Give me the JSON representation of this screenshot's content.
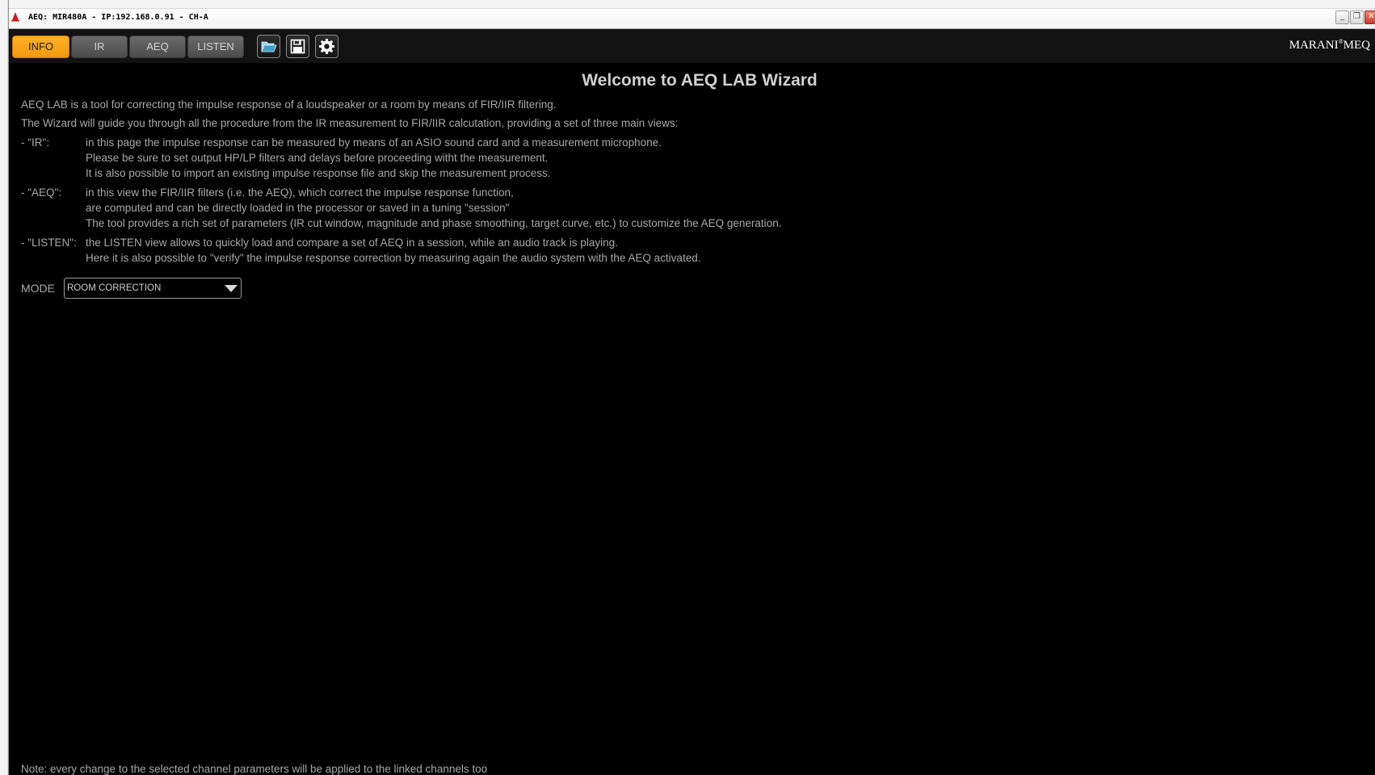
{
  "window": {
    "title": "AEQ: MIR480A - IP:192.168.0.91 - CH-A",
    "min_glyph": "_",
    "restore_glyph": "❐",
    "close_glyph": "✕"
  },
  "toolbar": {
    "tabs": [
      {
        "label": "INFO",
        "active": true
      },
      {
        "label": "IR",
        "active": false
      },
      {
        "label": "AEQ",
        "active": false
      },
      {
        "label": "LISTEN",
        "active": false
      }
    ],
    "icons": [
      "folder-open-icon",
      "save-icon",
      "settings-gear-icon"
    ],
    "brand": "MARANI",
    "brand_reg": "®",
    "brand_suffix": "MEQ",
    "colors": {
      "active_tab": "#f7a21b",
      "inactive_tab": "#5a5a5a"
    }
  },
  "content": {
    "title": "Welcome to AEQ LAB Wizard",
    "intro": [
      "AEQ LAB is a tool for correcting the impulse response of a loudspeaker or a room by means of FIR/IIR filtering.",
      "The Wizard will guide you through all the procedure from the IR measurement to FIR/IIR calcutation, providing a set of three main views:"
    ],
    "views": [
      {
        "term": "- \"IR\":",
        "lines": [
          "in this page the impulse response can be measured by means of an ASIO sound card and a measurement microphone.",
          "Please be sure to set output HP/LP filters and delays before proceeding witht the measurement.",
          "It is also possible to import an existing impulse response file and skip the measurement process."
        ]
      },
      {
        "term": "- \"AEQ\":",
        "lines": [
          "in this view the FIR/IIR filters (i.e. the AEQ), which correct the impulse response function,",
          "are computed and can be directly loaded in the processor or saved in a tuning \"session\"",
          "The tool provides a rich set of parameters (IR cut window, magnitude and phase smoothing, target curve, etc.) to customize the AEQ generation."
        ]
      },
      {
        "term": "- \"LISTEN\":",
        "lines": [
          "the LISTEN view allows to quickly load and compare a set of AEQ in a session, while an audio track is playing.",
          "Here it is also possible to \"verify\" the impulse response correction by measuring again the audio system with the AEQ activated."
        ]
      }
    ],
    "mode_label": "MODE",
    "mode_value": "ROOM CORRECTION",
    "note": "Note: every change to the selected channel parameters will be applied to the linked channels too"
  }
}
